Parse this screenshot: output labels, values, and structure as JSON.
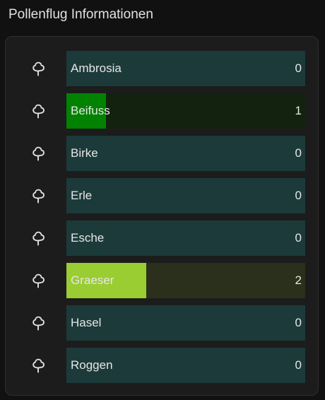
{
  "header": {
    "title": "Pollenflug Informationen"
  },
  "scale_max": 6,
  "rows": [
    {
      "label": "Ambrosia",
      "value": "0",
      "level": 0,
      "bar_color": "#1c3a3a",
      "fill_color": "#1c3a3a",
      "icon": "tree-icon"
    },
    {
      "label": "Beifuss",
      "value": "1",
      "level": 1,
      "bar_color": "#13220f",
      "fill_color": "#018201",
      "icon": "tree-icon"
    },
    {
      "label": "Birke",
      "value": "0",
      "level": 0,
      "bar_color": "#1c3a3a",
      "fill_color": "#1c3a3a",
      "icon": "tree-icon"
    },
    {
      "label": "Erle",
      "value": "0",
      "level": 0,
      "bar_color": "#1c3a3a",
      "fill_color": "#1c3a3a",
      "icon": "tree-icon"
    },
    {
      "label": "Esche",
      "value": "0",
      "level": 0,
      "bar_color": "#1c3a3a",
      "fill_color": "#1c3a3a",
      "icon": "tree-icon"
    },
    {
      "label": "Graeser",
      "value": "2",
      "level": 2,
      "bar_color": "#2a301b",
      "fill_color": "#9acd32",
      "icon": "tree-icon"
    },
    {
      "label": "Hasel",
      "value": "0",
      "level": 0,
      "bar_color": "#1c3a3a",
      "fill_color": "#1c3a3a",
      "icon": "tree-icon"
    },
    {
      "label": "Roggen",
      "value": "0",
      "level": 0,
      "bar_color": "#1c3a3a",
      "fill_color": "#1c3a3a",
      "icon": "tree-icon"
    }
  ]
}
